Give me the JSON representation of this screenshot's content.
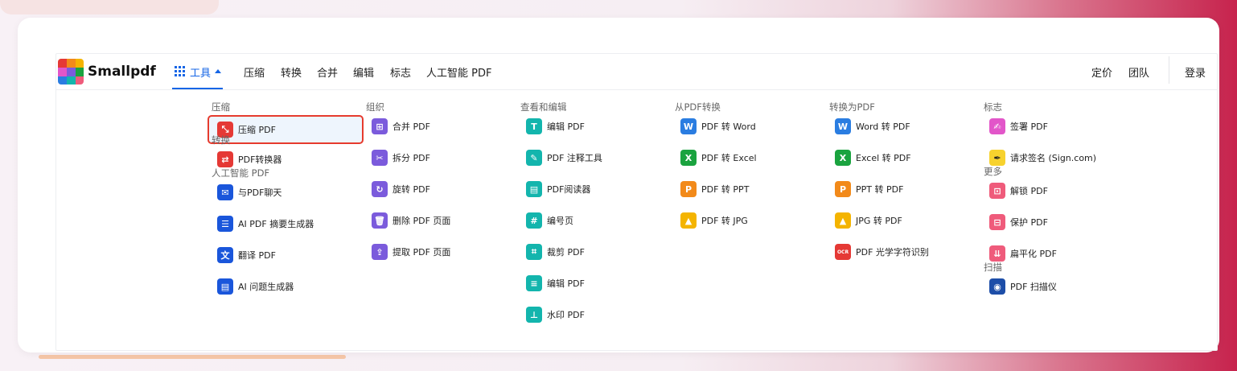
{
  "brand": "Smallpdf",
  "nav": {
    "tools_label": "工具",
    "links": [
      "压缩",
      "转换",
      "合并",
      "编辑",
      "标志",
      "人工智能 PDF"
    ],
    "pricing": "定价",
    "team": "团队",
    "login": "登录"
  },
  "columns": [
    {
      "sections": [
        {
          "header": "压缩",
          "items": [
            {
              "label": "压缩 PDF",
              "icon": "compress-icon",
              "color": "#e53935",
              "selected": true
            }
          ]
        },
        {
          "header": "转换",
          "items": [
            {
              "label": "PDF转换器",
              "icon": "converter-icon",
              "color": "#e53935"
            }
          ]
        },
        {
          "header": "人工智能 PDF",
          "items": [
            {
              "label": "与PDF聊天",
              "icon": "ai-chat-icon",
              "color": "#1a56db"
            },
            {
              "label": "AI PDF 摘要生成器",
              "icon": "list-icon",
              "color": "#1a56db"
            },
            {
              "label": "翻译 PDF",
              "icon": "translate-icon",
              "color": "#1a56db"
            },
            {
              "label": "AI 问题生成器",
              "icon": "question-doc-icon",
              "color": "#1a56db"
            }
          ]
        }
      ]
    },
    {
      "sections": [
        {
          "header": "组织",
          "items": [
            {
              "label": "合并 PDF",
              "icon": "merge-icon",
              "color": "#7b5bdc"
            },
            {
              "label": "拆分 PDF",
              "icon": "scissors-icon",
              "color": "#7b5bdc"
            },
            {
              "label": "旋转 PDF",
              "icon": "rotate-icon",
              "color": "#7b5bdc"
            },
            {
              "label": "删除 PDF 页面",
              "icon": "trash-icon",
              "color": "#7b5bdc"
            },
            {
              "label": "提取 PDF 页面",
              "icon": "extract-icon",
              "color": "#7b5bdc"
            }
          ]
        }
      ]
    },
    {
      "sections": [
        {
          "header": "查看和编辑",
          "items": [
            {
              "label": "编辑 PDF",
              "icon": "text-edit-icon",
              "color": "#13b5ad"
            },
            {
              "label": "PDF 注释工具",
              "icon": "pencil-icon",
              "color": "#13b5ad"
            },
            {
              "label": "PDF阅读器",
              "icon": "reader-icon",
              "color": "#13b5ad"
            },
            {
              "label": "编号页",
              "icon": "page-number-icon",
              "color": "#13b5ad"
            },
            {
              "label": "裁剪 PDF",
              "icon": "crop-icon",
              "color": "#13b5ad"
            },
            {
              "label": "编辑 PDF",
              "icon": "form-edit-icon",
              "color": "#13b5ad"
            },
            {
              "label": "水印 PDF",
              "icon": "stamp-icon",
              "color": "#13b5ad"
            }
          ]
        }
      ]
    },
    {
      "sections": [
        {
          "header": "从PDF转换",
          "items": [
            {
              "label": "PDF 转 Word",
              "icon": "word-icon",
              "color": "#2a7de1",
              "glyph": "W"
            },
            {
              "label": "PDF 转 Excel",
              "icon": "excel-icon",
              "color": "#1aa33f",
              "glyph": "X"
            },
            {
              "label": "PDF 转 PPT",
              "icon": "ppt-icon",
              "color": "#f28a1a",
              "glyph": "P"
            },
            {
              "label": "PDF 转 JPG",
              "icon": "image-icon",
              "color": "#f4b400"
            }
          ]
        }
      ]
    },
    {
      "sections": [
        {
          "header": "转换为PDF",
          "items": [
            {
              "label": "Word 转 PDF",
              "icon": "word-icon",
              "color": "#2a7de1",
              "glyph": "W"
            },
            {
              "label": "Excel 转 PDF",
              "icon": "excel-icon",
              "color": "#1aa33f",
              "glyph": "X"
            },
            {
              "label": "PPT 转 PDF",
              "icon": "ppt-icon",
              "color": "#f28a1a",
              "glyph": "P"
            },
            {
              "label": "JPG 转 PDF",
              "icon": "image-icon",
              "color": "#f4b400"
            },
            {
              "label": "PDF 光学字符识别",
              "icon": "ocr-icon",
              "color": "#e53935",
              "glyph": "OCR"
            }
          ]
        }
      ]
    },
    {
      "sections": [
        {
          "header": "标志",
          "items": [
            {
              "label": "签署 PDF",
              "icon": "signature-icon",
              "color": "#e256c9"
            },
            {
              "label": "请求签名 (Sign.com)",
              "icon": "pen-nib-icon",
              "color": "#f7d22e"
            }
          ]
        },
        {
          "header": "更多",
          "items": [
            {
              "label": "解锁 PDF",
              "icon": "unlock-icon",
              "color": "#ef5b7b"
            },
            {
              "label": "保护 PDF",
              "icon": "lock-icon",
              "color": "#ef5b7b"
            },
            {
              "label": "扁平化 PDF",
              "icon": "flatten-icon",
              "color": "#ef5b7b"
            }
          ]
        },
        {
          "header": "扫描",
          "items": [
            {
              "label": "PDF 扫描仪",
              "icon": "camera-icon",
              "color": "#1d4ea8"
            }
          ]
        }
      ]
    }
  ]
}
